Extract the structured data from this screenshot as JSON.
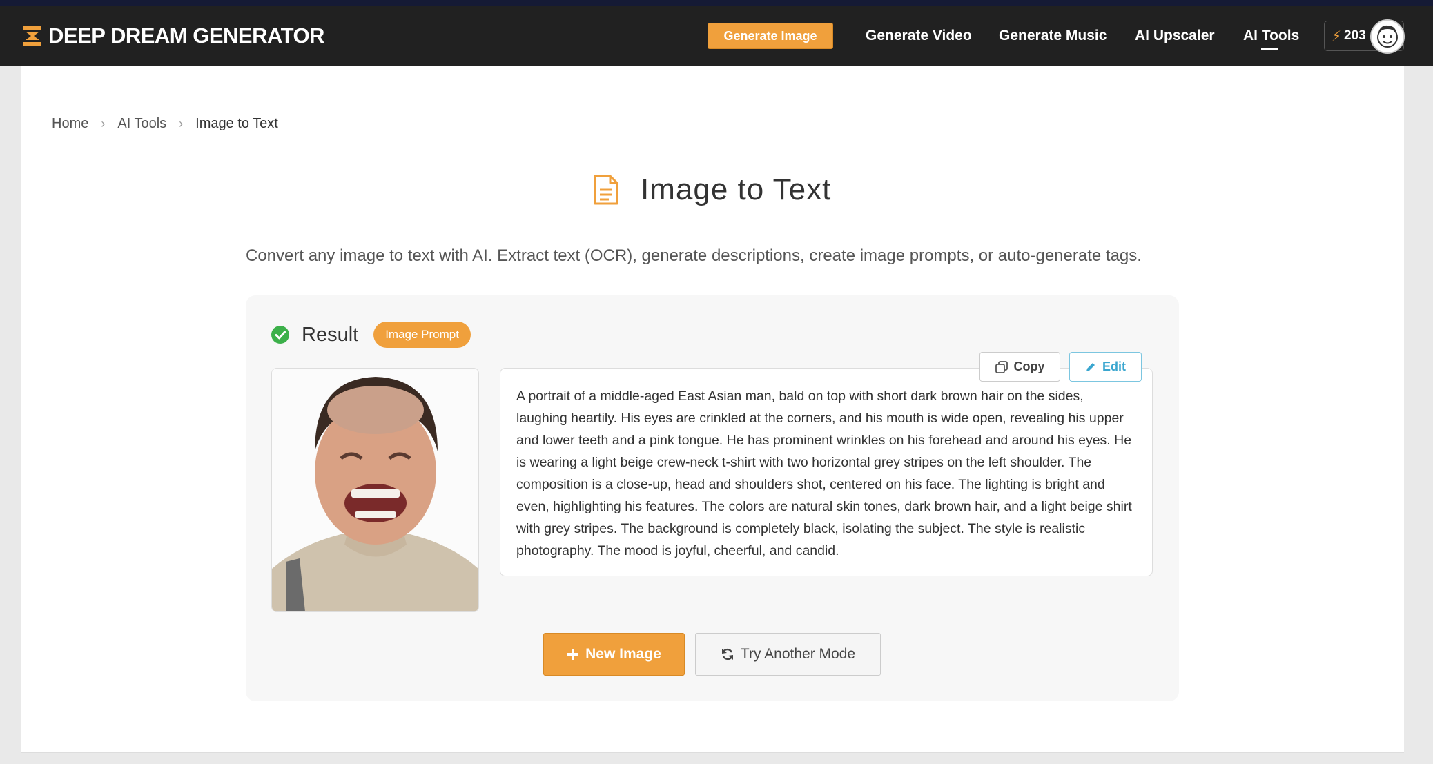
{
  "header": {
    "logo_text": "DEEP DREAM GENERATOR",
    "nav": {
      "generate_image": "Generate Image",
      "generate_video": "Generate Video",
      "generate_music": "Generate Music",
      "ai_upscaler": "AI Upscaler",
      "ai_tools": "AI Tools"
    },
    "credits": "203",
    "accent_color": "#f0a03c"
  },
  "breadcrumb": {
    "items": [
      "Home",
      "AI Tools",
      "Image to Text"
    ]
  },
  "page": {
    "title": "Image to Text",
    "subtitle": "Convert any image to text with AI. Extract text (OCR), generate descriptions, create image prompts, or auto-generate tags."
  },
  "result": {
    "label": "Result",
    "mode_badge": "Image Prompt",
    "copy_label": "Copy",
    "edit_label": "Edit",
    "text": "A portrait of a middle-aged East Asian man, bald on top with short dark brown hair on the sides, laughing heartily. His eyes are crinkled at the corners, and his mouth is wide open, revealing his upper and lower teeth and a pink tongue. He has prominent wrinkles on his forehead and around his eyes. He is wearing a light beige crew-neck t-shirt with two horizontal grey stripes on the left shoulder. The composition is a close-up, head and shoulders shot, centered on his face. The lighting is bright and even, highlighting his features. The colors are natural skin tones, dark brown hair, and a light beige shirt with grey stripes. The background is completely black, isolating the subject. The style is realistic photography. The mood is joyful, cheerful, and candid."
  },
  "actions": {
    "new_image": "New Image",
    "try_another_mode": "Try Another Mode"
  }
}
